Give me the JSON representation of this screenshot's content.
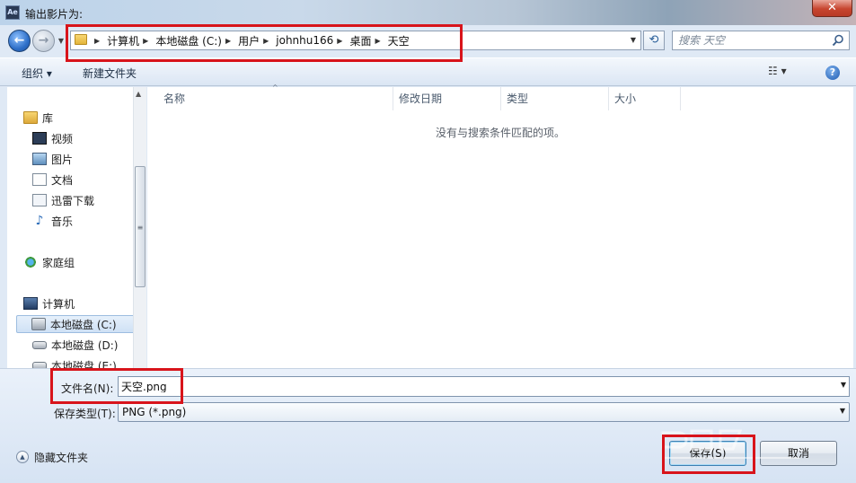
{
  "window": {
    "title": "输出影片为:",
    "app_icon_text": "Ae",
    "close_glyph": "✕"
  },
  "navigation": {
    "back_glyph": "←",
    "forward_glyph": "→",
    "history_drop_glyph": "▼",
    "breadcrumbs": [
      "计算机",
      "本地磁盘 (C:)",
      "用户",
      "johnhu166",
      "桌面",
      "天空"
    ],
    "address_drop_glyph": "▼",
    "refresh_glyph": "⟲",
    "search_placeholder": "搜索 天空"
  },
  "toolbar": {
    "organize_label": "组织 ▾",
    "new_folder_label": "新建文件夹",
    "views_glyph": "☷ ▾",
    "help_glyph": "?"
  },
  "nav_pane": {
    "items": [
      {
        "label": "库",
        "icon": "library-icon"
      },
      {
        "label": "视频",
        "icon": "video-icon"
      },
      {
        "label": "图片",
        "icon": "picture-icon"
      },
      {
        "label": "文档",
        "icon": "document-icon"
      },
      {
        "label": "迅雷下载",
        "icon": "download-icon"
      },
      {
        "label": "音乐",
        "icon": "music-icon"
      },
      {
        "label": "家庭组",
        "icon": "homegroup-icon"
      },
      {
        "label": "计算机",
        "icon": "computer-icon"
      },
      {
        "label": "本地磁盘 (C:)",
        "icon": "system-drive-icon"
      },
      {
        "label": "本地磁盘 (D:)",
        "icon": "drive-icon"
      },
      {
        "label": "本地磁盘 (E:)",
        "icon": "drive-icon"
      }
    ],
    "scroll_up_glyph": "▲",
    "scroll_grip": "≡"
  },
  "file_list": {
    "columns": [
      "名称",
      "修改日期",
      "类型",
      "大小"
    ],
    "sort_glyph": "^",
    "empty_message": "没有与搜索条件匹配的项。"
  },
  "save_form": {
    "filename_label": "文件名(N):",
    "filename_value": "天空.png",
    "filetype_label": "保存类型(T):",
    "filetype_value": "PNG (*.png)",
    "drop_glyph": "▼",
    "hide_folders_label": "隐藏文件夹",
    "hide_folders_glyph": "▲",
    "save_label": "保存(S)",
    "cancel_label": "取消"
  },
  "colors": {
    "highlight_box": "#d8141b",
    "dialog_background": "#dfe9f5",
    "accent_blue": "#2e6fc8"
  }
}
